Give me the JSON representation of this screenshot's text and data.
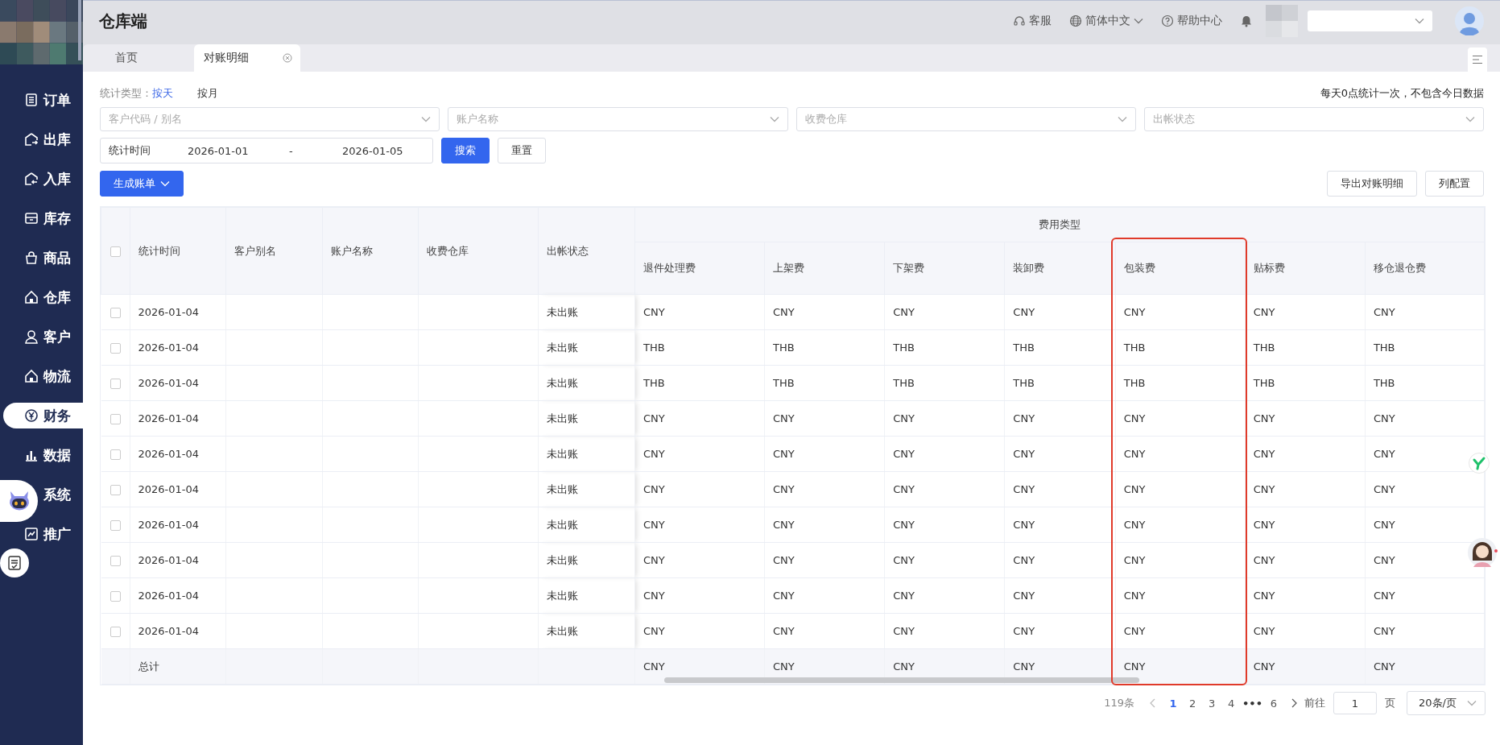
{
  "app": {
    "title": "仓库端"
  },
  "sidebar": {
    "items": [
      {
        "label": "订单",
        "selected": false
      },
      {
        "label": "出库",
        "selected": false
      },
      {
        "label": "入库",
        "selected": false
      },
      {
        "label": "库存",
        "selected": false
      },
      {
        "label": "商品",
        "selected": false
      },
      {
        "label": "仓库",
        "selected": false
      },
      {
        "label": "客户",
        "selected": false
      },
      {
        "label": "物流",
        "selected": false
      },
      {
        "label": "财务",
        "selected": true
      },
      {
        "label": "数据",
        "selected": false
      },
      {
        "label": "系统",
        "selected": false
      },
      {
        "label": "推广",
        "selected": false
      }
    ]
  },
  "header": {
    "actions": [
      {
        "label": "客服",
        "kind": "support"
      },
      {
        "label": "简体中文",
        "kind": "language"
      },
      {
        "label": "帮助中心",
        "kind": "help"
      }
    ]
  },
  "tabs": [
    {
      "label": "首页",
      "selected": false
    },
    {
      "label": "对账明细",
      "selected": true
    }
  ],
  "stat_type": {
    "label": "统计类型：",
    "options": [
      {
        "label": "按天",
        "selected": true
      },
      {
        "label": "按月",
        "selected": false
      }
    ]
  },
  "note": "每天0点统计一次，不包含今日数据",
  "filters": [
    {
      "placeholder": "客户代码 / 别名"
    },
    {
      "placeholder": "账户名称"
    },
    {
      "placeholder": "收费仓库"
    },
    {
      "placeholder": "出帐状态"
    }
  ],
  "date_range": {
    "label": "统计时间",
    "start": "2026-01-01",
    "separator": "-",
    "end": "2026-01-05"
  },
  "buttons": {
    "search": "搜索",
    "reset": "重置",
    "generate": "生成账单",
    "export": "导出对账明细",
    "columns": "列配置"
  },
  "table": {
    "group_header": "费用类型",
    "select_all_checked": false,
    "fixed_columns": [
      "统计时间",
      "客户别名",
      "账户名称",
      "收费仓库",
      "出帐状态"
    ],
    "fee_columns": [
      {
        "label": "退件处理费",
        "highlighted": false
      },
      {
        "label": "上架费",
        "highlighted": false
      },
      {
        "label": "下架费",
        "highlighted": false
      },
      {
        "label": "装卸费",
        "highlighted": false
      },
      {
        "label": "包装费",
        "highlighted": true
      },
      {
        "label": "贴标费",
        "highlighted": false
      },
      {
        "label": "移仓退仓费",
        "highlighted": false
      }
    ],
    "rows": [
      {
        "checked": false,
        "date": "2026-01-04",
        "status": "未出账",
        "fees": [
          "CNY",
          "CNY",
          "CNY",
          "CNY",
          "CNY",
          "CNY",
          "CNY"
        ]
      },
      {
        "checked": false,
        "date": "2026-01-04",
        "status": "未出账",
        "fees": [
          "THB",
          "THB",
          "THB",
          "THB",
          "THB",
          "THB",
          "THB"
        ]
      },
      {
        "checked": false,
        "date": "2026-01-04",
        "status": "未出账",
        "fees": [
          "THB",
          "THB",
          "THB",
          "THB",
          "THB",
          "THB",
          "THB"
        ]
      },
      {
        "checked": false,
        "date": "2026-01-04",
        "status": "未出账",
        "fees": [
          "CNY",
          "CNY",
          "CNY",
          "CNY",
          "CNY",
          "CNY",
          "CNY"
        ]
      },
      {
        "checked": false,
        "date": "2026-01-04",
        "status": "未出账",
        "fees": [
          "CNY",
          "CNY",
          "CNY",
          "CNY",
          "CNY",
          "CNY",
          "CNY"
        ]
      },
      {
        "checked": false,
        "date": "2026-01-04",
        "status": "未出账",
        "fees": [
          "CNY",
          "CNY",
          "CNY",
          "CNY",
          "CNY",
          "CNY",
          "CNY"
        ]
      },
      {
        "checked": false,
        "date": "2026-01-04",
        "status": "未出账",
        "fees": [
          "CNY",
          "CNY",
          "CNY",
          "CNY",
          "CNY",
          "CNY",
          "CNY"
        ]
      },
      {
        "checked": false,
        "date": "2026-01-04",
        "status": "未出账",
        "fees": [
          "CNY",
          "CNY",
          "CNY",
          "CNY",
          "CNY",
          "CNY",
          "CNY"
        ]
      },
      {
        "checked": false,
        "date": "2026-01-04",
        "status": "未出账",
        "fees": [
          "CNY",
          "CNY",
          "CNY",
          "CNY",
          "CNY",
          "CNY",
          "CNY"
        ]
      },
      {
        "checked": false,
        "date": "2026-01-04",
        "status": "未出账",
        "fees": [
          "CNY",
          "CNY",
          "CNY",
          "CNY",
          "CNY",
          "CNY",
          "CNY"
        ]
      }
    ],
    "total": {
      "label": "总计",
      "fees": [
        "CNY",
        "CNY",
        "CNY",
        "CNY",
        "CNY",
        "CNY",
        "CNY"
      ]
    }
  },
  "pagination": {
    "total": "119条",
    "pages": [
      {
        "label": "1",
        "kind": "page",
        "selected": true
      },
      {
        "label": "2",
        "kind": "page",
        "selected": false
      },
      {
        "label": "3",
        "kind": "page",
        "selected": false
      },
      {
        "label": "4",
        "kind": "page",
        "selected": false
      },
      {
        "label": "•••",
        "kind": "ellipsis"
      },
      {
        "label": "6",
        "kind": "page",
        "selected": false
      }
    ],
    "goto_label": "前往",
    "page_input": "1",
    "page_unit": "页",
    "page_size": "20条/页"
  }
}
